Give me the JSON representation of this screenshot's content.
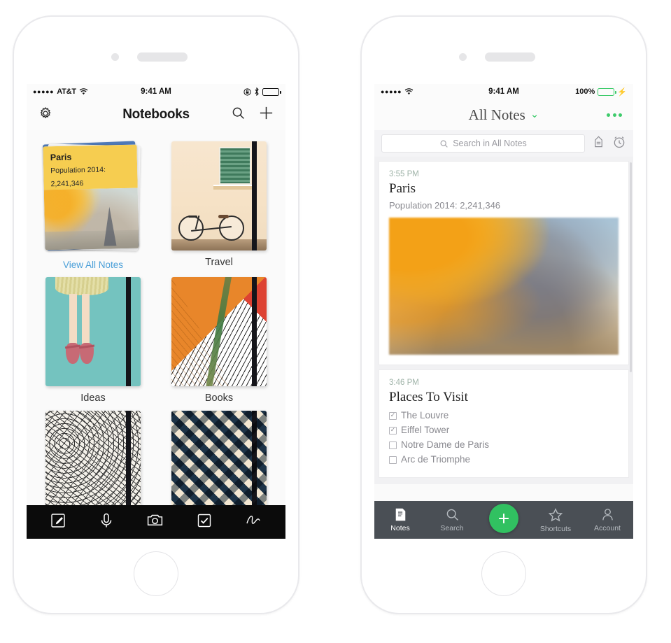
{
  "left_phone": {
    "status_bar": {
      "signal_dots": "●●●●●",
      "carrier": "AT&T",
      "wifi_icon": "wifi-icon",
      "time": "9:41 AM",
      "rotation_lock_icon": "rotation-lock-icon",
      "bluetooth_icon": "bluetooth-icon",
      "battery_icon": "battery-icon"
    },
    "nav": {
      "settings_icon": "gear-icon",
      "title": "Notebooks",
      "search_icon": "search-icon",
      "add_icon": "plus-icon"
    },
    "notebooks": [
      {
        "label": "View All Notes",
        "is_link": true,
        "cover": "paris-note-stack",
        "note": {
          "title": "Paris",
          "line1": "Population 2014:",
          "line2": "2,241,346"
        }
      },
      {
        "label": "Travel",
        "is_link": false,
        "cover": "travel-bicycle"
      },
      {
        "label": "Ideas",
        "is_link": false,
        "cover": "ideas-ballet"
      },
      {
        "label": "Books",
        "is_link": false,
        "cover": "books-geometric"
      },
      {
        "label": "",
        "is_link": false,
        "cover": "doodle-pattern"
      },
      {
        "label": "",
        "is_link": false,
        "cover": "chevron-pattern"
      }
    ],
    "toolbar": [
      {
        "icon": "compose-note-icon",
        "name": "new-text-note"
      },
      {
        "icon": "microphone-icon",
        "name": "new-audio-note"
      },
      {
        "icon": "camera-icon",
        "name": "new-photo-note"
      },
      {
        "icon": "checkbox-icon",
        "name": "new-checklist-note"
      },
      {
        "icon": "handwriting-icon",
        "name": "new-handwriting-note"
      }
    ]
  },
  "right_phone": {
    "status_bar": {
      "signal_dots": "●●●●●",
      "wifi_icon": "wifi-icon",
      "time": "9:41 AM",
      "battery_percent": "100%",
      "battery_icon": "battery-icon",
      "charging_icon": "⚡"
    },
    "nav": {
      "title": "All Notes",
      "chevron_icon": "chevron-down-icon",
      "overflow_icon": "more-options-icon"
    },
    "search": {
      "placeholder": "Search in All Notes",
      "search_icon": "search-icon",
      "tag_icon": "tag-icon",
      "reminder_icon": "alarm-clock-icon"
    },
    "notes": [
      {
        "time": "3:55 PM",
        "title": "Paris",
        "subtitle": "Population 2014: 2,241,346",
        "has_image": true
      },
      {
        "time": "3:46 PM",
        "title": "Places To Visit",
        "checklist": [
          {
            "label": "The Louvre",
            "checked": true
          },
          {
            "label": "Eiffel Tower",
            "checked": true
          },
          {
            "label": "Notre Dame de Paris",
            "checked": false
          },
          {
            "label": "Arc de Triomphe",
            "checked": false
          }
        ]
      }
    ],
    "tabs": [
      {
        "label": "Notes",
        "icon": "notes-icon",
        "active": true
      },
      {
        "label": "Search",
        "icon": "search-icon",
        "active": false
      },
      {
        "label": "",
        "icon": "plus-fab-icon",
        "active": false,
        "is_fab": true
      },
      {
        "label": "Shortcuts",
        "icon": "star-icon",
        "active": false
      },
      {
        "label": "Account",
        "icon": "person-icon",
        "active": false
      }
    ]
  },
  "colors": {
    "accent_green": "#3ecb6b",
    "link_blue": "#4a9fd8",
    "tabbar_bg": "#4a4f55",
    "toolbar_black": "#0b0b0b",
    "sticky_yellow": "#f6cd50"
  }
}
